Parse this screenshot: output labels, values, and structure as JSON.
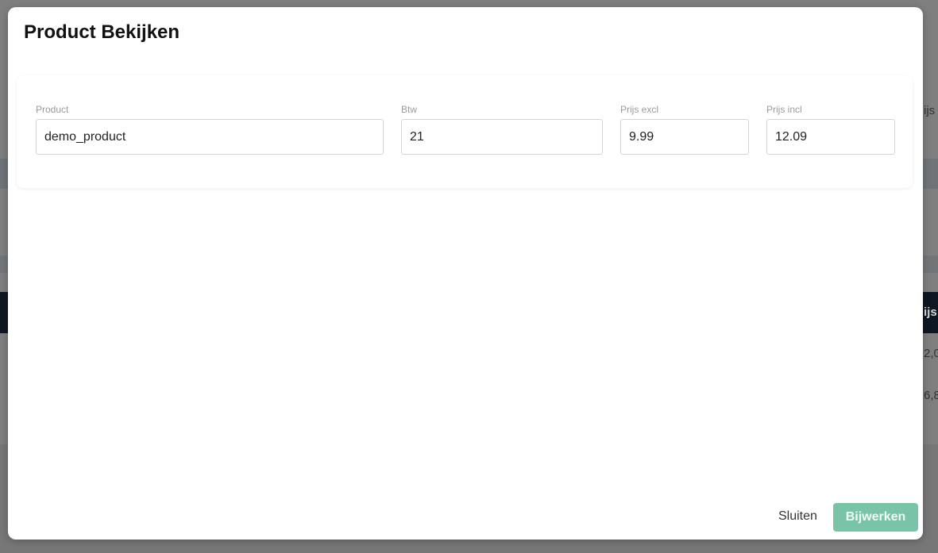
{
  "background": {
    "header_fragment": "ijs",
    "table_header_fragment": "ijs",
    "row1_value_fragment": "2,0",
    "row2_value_fragment": "6,8"
  },
  "modal": {
    "title": "Product Bekijken",
    "fields": {
      "product": {
        "label": "Product",
        "value": "demo_product"
      },
      "btw": {
        "label": "Btw",
        "value": "21"
      },
      "prijs_excl": {
        "label": "Prijs excl",
        "value": "9.99"
      },
      "prijs_incl": {
        "label": "Prijs incl",
        "value": "12.09"
      }
    },
    "buttons": {
      "close_label": "Sluiten",
      "update_label": "Bijwerken"
    }
  },
  "colors": {
    "accent": "#79c4a6",
    "table_header": "#0f1722"
  }
}
